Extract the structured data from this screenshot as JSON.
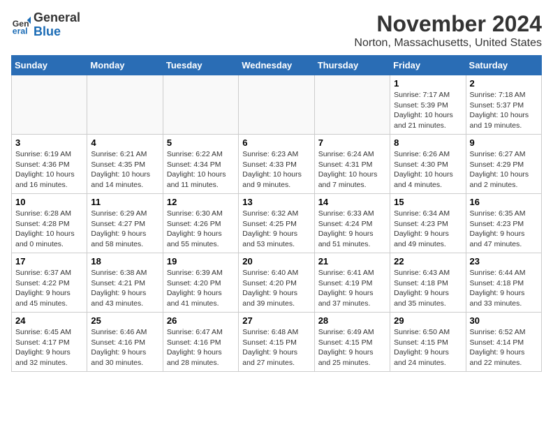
{
  "header": {
    "logo": {
      "line1": "General",
      "line2": "Blue"
    },
    "title": "November 2024",
    "location": "Norton, Massachusetts, United States"
  },
  "weekdays": [
    "Sunday",
    "Monday",
    "Tuesday",
    "Wednesday",
    "Thursday",
    "Friday",
    "Saturday"
  ],
  "weeks": [
    [
      {
        "day": "",
        "info": ""
      },
      {
        "day": "",
        "info": ""
      },
      {
        "day": "",
        "info": ""
      },
      {
        "day": "",
        "info": ""
      },
      {
        "day": "",
        "info": ""
      },
      {
        "day": "1",
        "info": "Sunrise: 7:17 AM\nSunset: 5:39 PM\nDaylight: 10 hours and 21 minutes."
      },
      {
        "day": "2",
        "info": "Sunrise: 7:18 AM\nSunset: 5:37 PM\nDaylight: 10 hours and 19 minutes."
      }
    ],
    [
      {
        "day": "3",
        "info": "Sunrise: 6:19 AM\nSunset: 4:36 PM\nDaylight: 10 hours and 16 minutes."
      },
      {
        "day": "4",
        "info": "Sunrise: 6:21 AM\nSunset: 4:35 PM\nDaylight: 10 hours and 14 minutes."
      },
      {
        "day": "5",
        "info": "Sunrise: 6:22 AM\nSunset: 4:34 PM\nDaylight: 10 hours and 11 minutes."
      },
      {
        "day": "6",
        "info": "Sunrise: 6:23 AM\nSunset: 4:33 PM\nDaylight: 10 hours and 9 minutes."
      },
      {
        "day": "7",
        "info": "Sunrise: 6:24 AM\nSunset: 4:31 PM\nDaylight: 10 hours and 7 minutes."
      },
      {
        "day": "8",
        "info": "Sunrise: 6:26 AM\nSunset: 4:30 PM\nDaylight: 10 hours and 4 minutes."
      },
      {
        "day": "9",
        "info": "Sunrise: 6:27 AM\nSunset: 4:29 PM\nDaylight: 10 hours and 2 minutes."
      }
    ],
    [
      {
        "day": "10",
        "info": "Sunrise: 6:28 AM\nSunset: 4:28 PM\nDaylight: 10 hours and 0 minutes."
      },
      {
        "day": "11",
        "info": "Sunrise: 6:29 AM\nSunset: 4:27 PM\nDaylight: 9 hours and 58 minutes."
      },
      {
        "day": "12",
        "info": "Sunrise: 6:30 AM\nSunset: 4:26 PM\nDaylight: 9 hours and 55 minutes."
      },
      {
        "day": "13",
        "info": "Sunrise: 6:32 AM\nSunset: 4:25 PM\nDaylight: 9 hours and 53 minutes."
      },
      {
        "day": "14",
        "info": "Sunrise: 6:33 AM\nSunset: 4:24 PM\nDaylight: 9 hours and 51 minutes."
      },
      {
        "day": "15",
        "info": "Sunrise: 6:34 AM\nSunset: 4:23 PM\nDaylight: 9 hours and 49 minutes."
      },
      {
        "day": "16",
        "info": "Sunrise: 6:35 AM\nSunset: 4:23 PM\nDaylight: 9 hours and 47 minutes."
      }
    ],
    [
      {
        "day": "17",
        "info": "Sunrise: 6:37 AM\nSunset: 4:22 PM\nDaylight: 9 hours and 45 minutes."
      },
      {
        "day": "18",
        "info": "Sunrise: 6:38 AM\nSunset: 4:21 PM\nDaylight: 9 hours and 43 minutes."
      },
      {
        "day": "19",
        "info": "Sunrise: 6:39 AM\nSunset: 4:20 PM\nDaylight: 9 hours and 41 minutes."
      },
      {
        "day": "20",
        "info": "Sunrise: 6:40 AM\nSunset: 4:20 PM\nDaylight: 9 hours and 39 minutes."
      },
      {
        "day": "21",
        "info": "Sunrise: 6:41 AM\nSunset: 4:19 PM\nDaylight: 9 hours and 37 minutes."
      },
      {
        "day": "22",
        "info": "Sunrise: 6:43 AM\nSunset: 4:18 PM\nDaylight: 9 hours and 35 minutes."
      },
      {
        "day": "23",
        "info": "Sunrise: 6:44 AM\nSunset: 4:18 PM\nDaylight: 9 hours and 33 minutes."
      }
    ],
    [
      {
        "day": "24",
        "info": "Sunrise: 6:45 AM\nSunset: 4:17 PM\nDaylight: 9 hours and 32 minutes."
      },
      {
        "day": "25",
        "info": "Sunrise: 6:46 AM\nSunset: 4:16 PM\nDaylight: 9 hours and 30 minutes."
      },
      {
        "day": "26",
        "info": "Sunrise: 6:47 AM\nSunset: 4:16 PM\nDaylight: 9 hours and 28 minutes."
      },
      {
        "day": "27",
        "info": "Sunrise: 6:48 AM\nSunset: 4:15 PM\nDaylight: 9 hours and 27 minutes."
      },
      {
        "day": "28",
        "info": "Sunrise: 6:49 AM\nSunset: 4:15 PM\nDaylight: 9 hours and 25 minutes."
      },
      {
        "day": "29",
        "info": "Sunrise: 6:50 AM\nSunset: 4:15 PM\nDaylight: 9 hours and 24 minutes."
      },
      {
        "day": "30",
        "info": "Sunrise: 6:52 AM\nSunset: 4:14 PM\nDaylight: 9 hours and 22 minutes."
      }
    ]
  ],
  "colors": {
    "header_bg": "#2a6db5",
    "header_text": "#ffffff"
  }
}
